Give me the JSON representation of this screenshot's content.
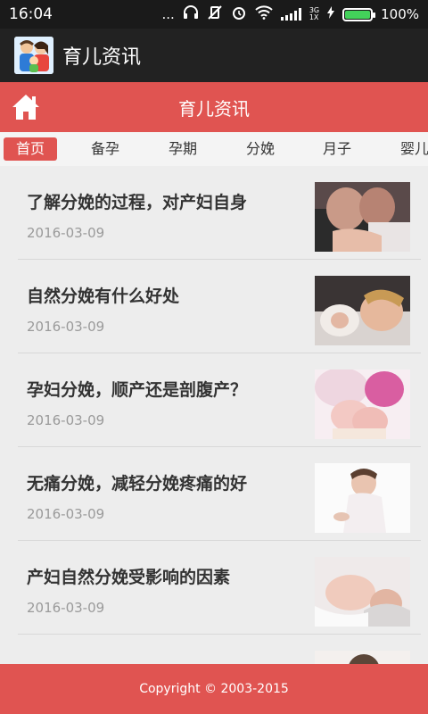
{
  "status_bar": {
    "time": "16:04",
    "dots": "...",
    "network": [
      "3G",
      "1X"
    ],
    "battery_level": 1.0,
    "battery_text": "100%",
    "battery_color": "#43d15a"
  },
  "app": {
    "title": "育儿资讯"
  },
  "header": {
    "title": "育儿资讯",
    "accent": "#e05451"
  },
  "tabs": [
    {
      "label": "首页",
      "active": true
    },
    {
      "label": "备孕"
    },
    {
      "label": "孕期"
    },
    {
      "label": "分娩"
    },
    {
      "label": "月子"
    },
    {
      "label": "婴儿"
    }
  ],
  "articles": [
    {
      "title": "了解分娩的过程，对产妇自身",
      "date": "2016-03-09"
    },
    {
      "title": "自然分娩有什么好处",
      "date": "2016-03-09"
    },
    {
      "title": "孕妇分娩，顺产还是剖腹产？",
      "date": "2016-03-09"
    },
    {
      "title": "无痛分娩，减轻分娩疼痛的好",
      "date": "2016-03-09"
    },
    {
      "title": "产妇自然分娩受影响的因素",
      "date": "2016-03-09"
    },
    {
      "title": "",
      "date": ""
    }
  ],
  "footer": {
    "copyright": "Copyright © 2003-2015"
  }
}
